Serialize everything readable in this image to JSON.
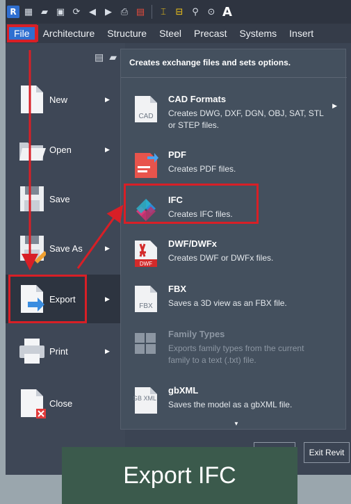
{
  "qat": {
    "icons": [
      "revit-logo",
      "info-icon",
      "open-icon",
      "save-icon",
      "sync-icon",
      "undo-icon",
      "redo-icon",
      "print-icon",
      "export-icon",
      "measure-icon",
      "dimension-icon",
      "tag-icon",
      "text-icon"
    ],
    "logo_letter": "R",
    "text_letter": "A"
  },
  "tabs": [
    "File",
    "Architecture",
    "Structure",
    "Steel",
    "Precast",
    "Systems",
    "Insert"
  ],
  "file_menu": {
    "items": [
      {
        "label": "New",
        "caret": true
      },
      {
        "label": "Open",
        "caret": true
      },
      {
        "label": "Save",
        "caret": false
      },
      {
        "label": "Save As",
        "caret": true
      },
      {
        "label": "Export",
        "caret": true
      },
      {
        "label": "Print",
        "caret": true
      },
      {
        "label": "Close",
        "caret": false
      }
    ]
  },
  "export_submenu": {
    "header": "Creates exchange files and sets options.",
    "items": [
      {
        "title": "CAD Formats",
        "description": "Creates DWG, DXF, DGN, OBJ, SAT, STL or STEP files.",
        "has_submenu": true,
        "disabled": false,
        "icon_text": "CAD"
      },
      {
        "title": "PDF",
        "description": "Creates PDF files.",
        "has_submenu": false,
        "disabled": false,
        "icon_text": ""
      },
      {
        "title": "IFC",
        "description": "Creates IFC files.",
        "has_submenu": false,
        "disabled": false,
        "icon_text": ""
      },
      {
        "title": "DWF/DWFx",
        "description": "Creates DWF or DWFx files.",
        "has_submenu": false,
        "disabled": false,
        "icon_text": "DWF"
      },
      {
        "title": "FBX",
        "description": "Saves a 3D view as an FBX file.",
        "has_submenu": false,
        "disabled": false,
        "icon_text": "FBX"
      },
      {
        "title": "Family Types",
        "description": "Exports family types from the current family to a text (.txt) file.",
        "has_submenu": false,
        "disabled": true,
        "icon_text": ""
      },
      {
        "title": "gbXML",
        "description": "Saves the model as a gbXML file.",
        "has_submenu": false,
        "disabled": false,
        "icon_text": "GB XML"
      }
    ]
  },
  "buttons": {
    "exit": "Exit Revit"
  },
  "caption": "Export IFC",
  "colors": {
    "highlight": "#d81f26",
    "accent": "#2f6fd1",
    "panel": "#44505e",
    "caption_bg": "#3b5a4c"
  }
}
